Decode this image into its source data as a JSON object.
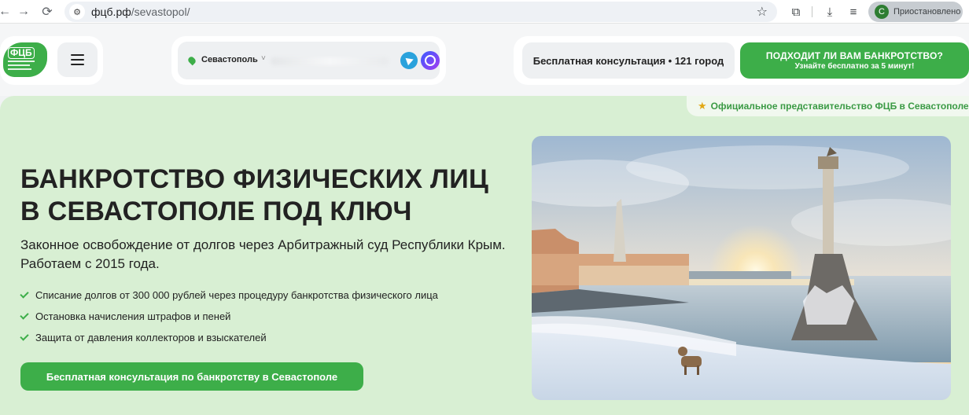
{
  "browser": {
    "url_host": "фцб.рф",
    "url_path": "/sevastopol/",
    "profile_initial": "С",
    "profile_label": "Приостановлено"
  },
  "header": {
    "logo_text": "ФЦБ",
    "city": "Севастополь",
    "consult_text": "Бесплатная консультация • 121 город",
    "cta_title": "ПОДХОДИТ ЛИ ВАМ БАНКРОТСТВО?",
    "cta_subtitle": "Узнайте бесплатно за 5 минут!"
  },
  "hero": {
    "badge": "Официальное представительство ФЦБ в Севастополе",
    "title_line1": "БАНКРОТСТВО ФИЗИЧЕСКИХ ЛИЦ",
    "title_line2": "В СЕВАСТОПОЛЕ ПОД КЛЮЧ",
    "subtitle": "Законное освобождение от долгов через Арбитражный суд Республики Крым. Работаем с 2015 года.",
    "bullets": [
      "Списание долгов от 300 000 рублей через процедуру банкротства физического лица",
      "Остановка начисления штрафов и пеней",
      "Защита от давления коллекторов и взыскателей"
    ],
    "cta": "Бесплатная консультация по банкротству в Севастополе"
  },
  "colors": {
    "brand_green": "#3dae49",
    "hero_bg": "#d8efd3"
  }
}
